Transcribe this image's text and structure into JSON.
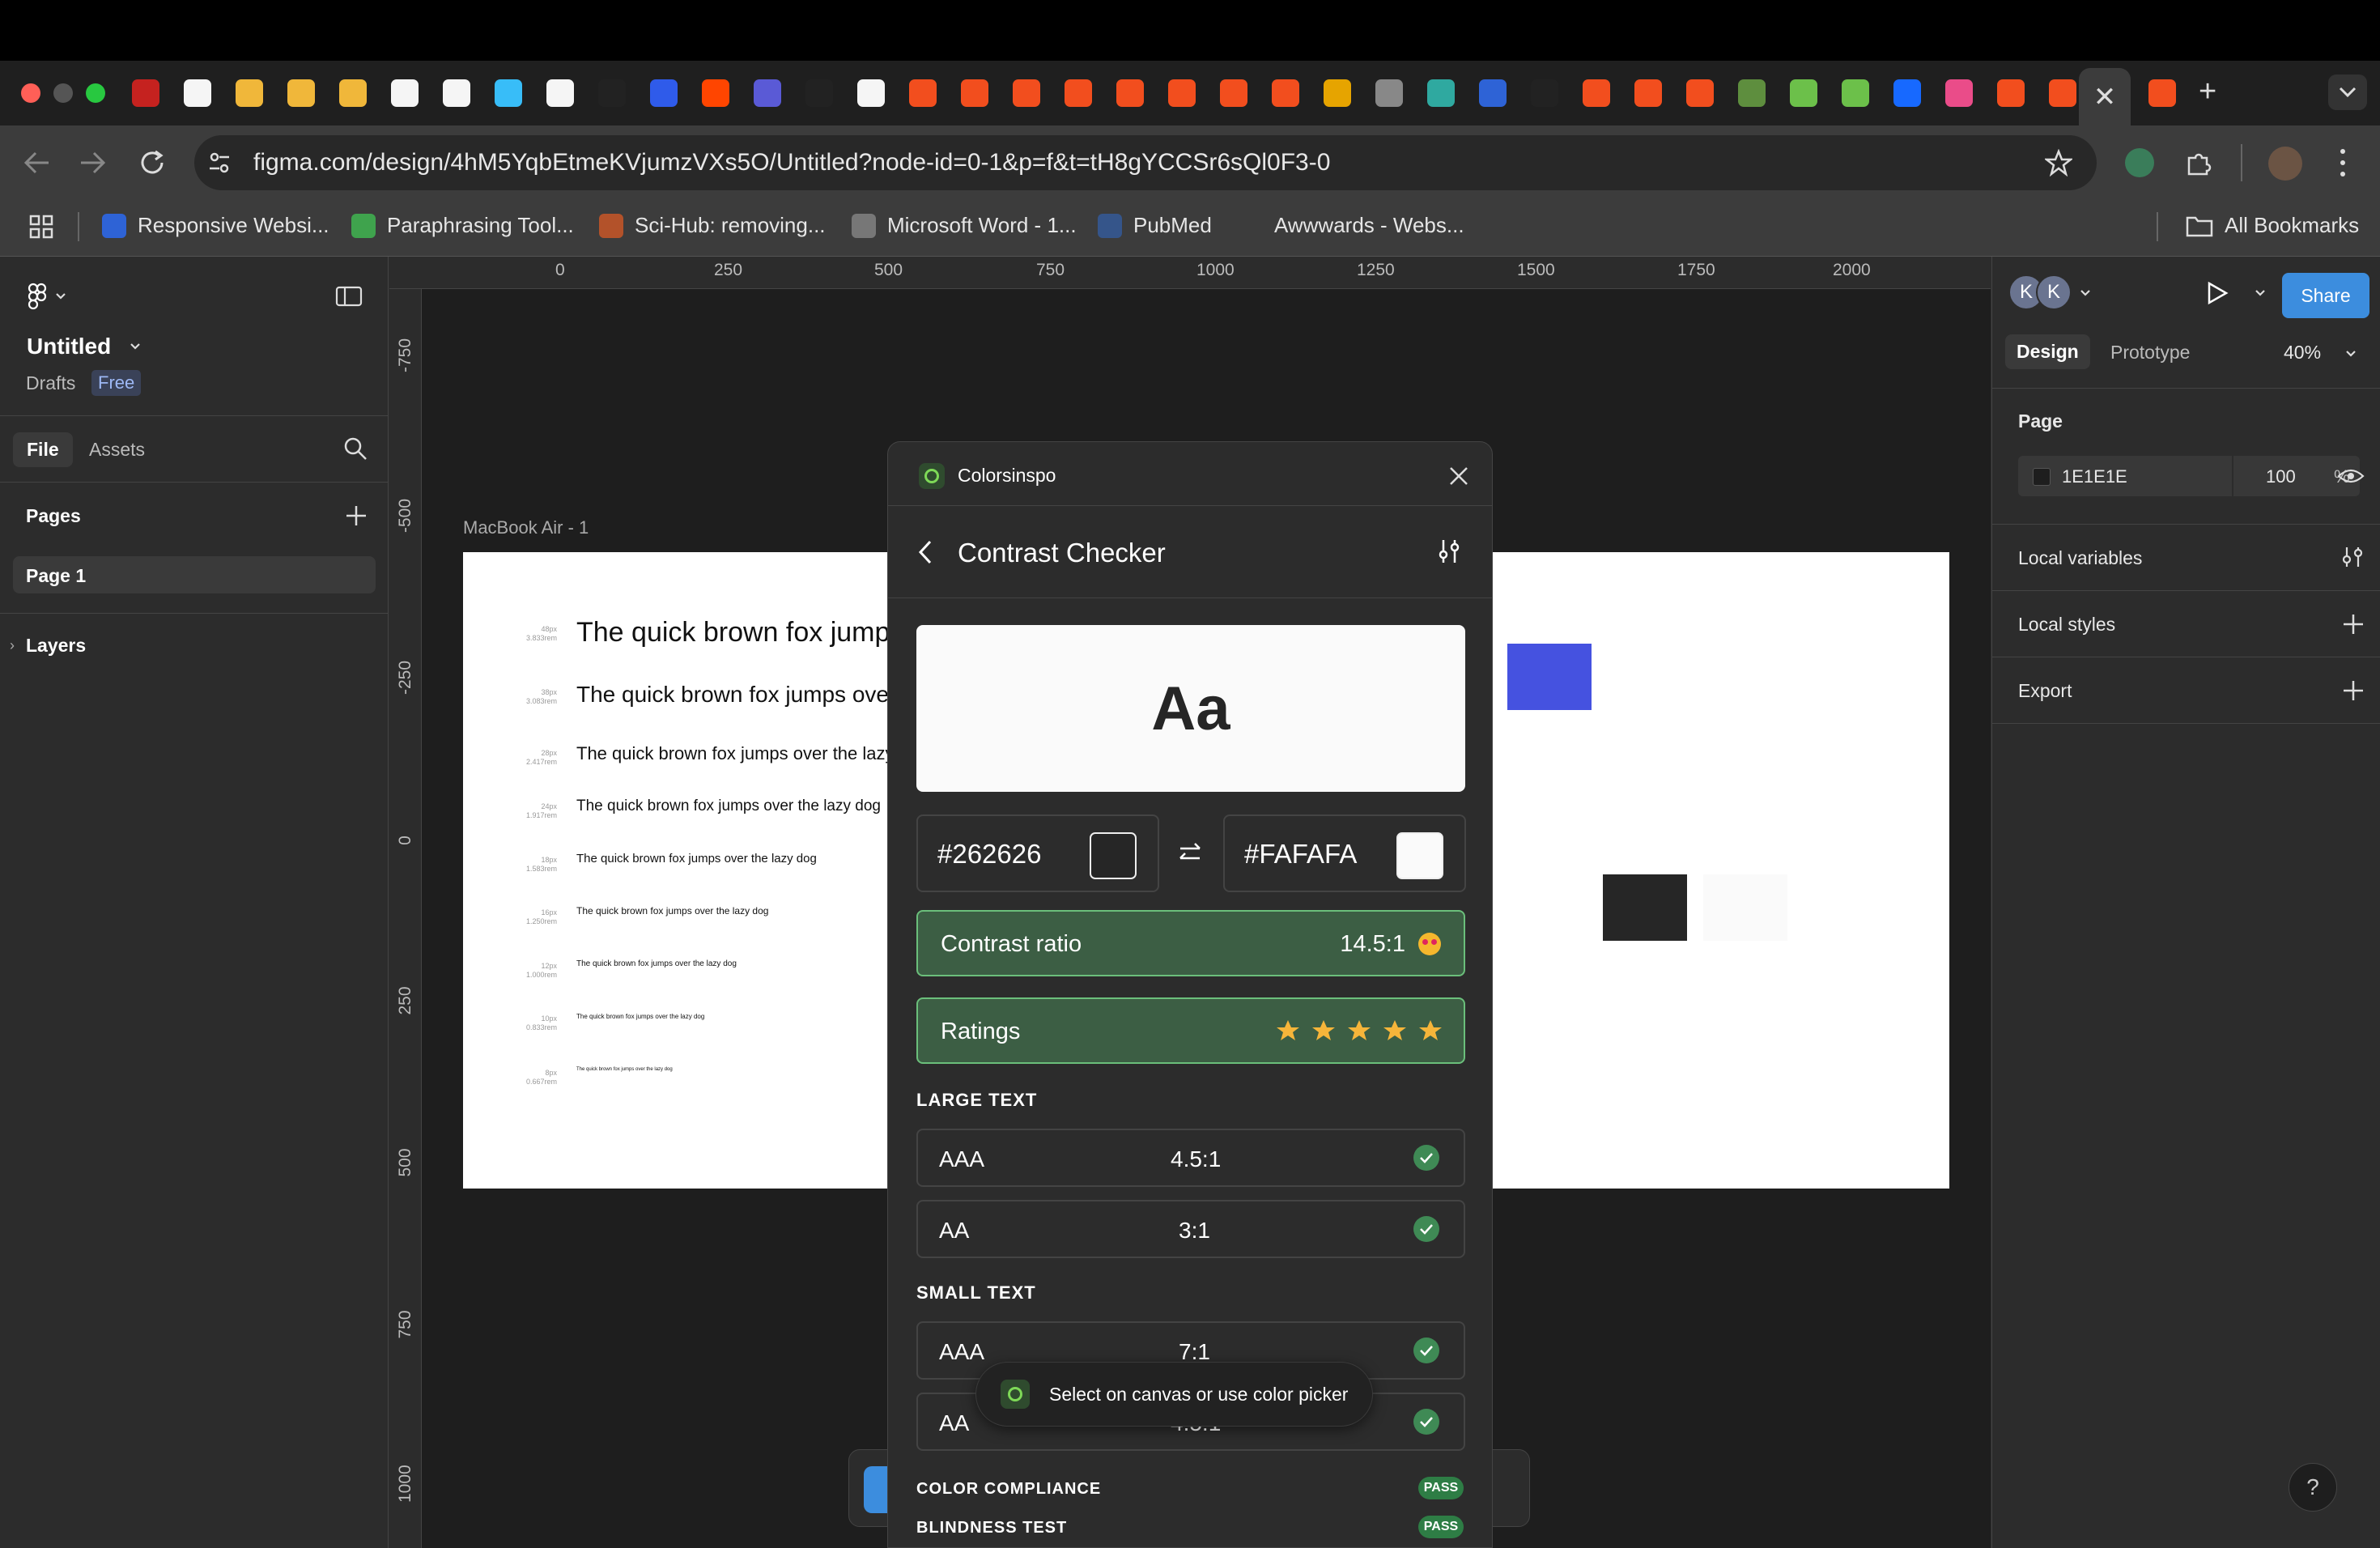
{
  "browser": {
    "active_tab_close": "✕",
    "new_tab": "+",
    "url": "figma.com/design/4hM5YqbEtmeKVjumzVXs5O/Untitled?node-id=0-1&p=f&t=tH8gYCCSr6sQl0F3-0",
    "bookmarks": [
      {
        "label": "Responsive Websi...",
        "icon": "c-logo-icon",
        "color": "#2e63d6"
      },
      {
        "label": "Paraphrasing Tool...",
        "icon": "robot-icon",
        "color": "#3fa34d"
      },
      {
        "label": "Sci-Hub: removing...",
        "icon": "sci-hub-icon",
        "color": "#b3522a"
      },
      {
        "label": "Microsoft Word - 1...",
        "icon": "globe-icon",
        "color": "#777777"
      },
      {
        "label": "PubMed",
        "icon": "pubmed-icon",
        "color": "#35558a"
      },
      {
        "label": "Awwwards - Webs...",
        "icon": "awwwards-icon",
        "color": "#3c3c3c"
      }
    ],
    "all_bookmarks": "All Bookmarks"
  },
  "figma": {
    "file_name": "Untitled",
    "location": "Drafts",
    "plan_badge": "Free",
    "tabs": {
      "file": "File",
      "assets": "Assets"
    },
    "pages_heading": "Pages",
    "pages": [
      "Page 1"
    ],
    "layers_heading": "Layers",
    "ruler_top": [
      "0",
      "250",
      "500",
      "750",
      "1000",
      "1250",
      "1500",
      "1750",
      "2000"
    ],
    "ruler_left": [
      "-750",
      "-500",
      "-250",
      "0",
      "250",
      "500",
      "750",
      "1000"
    ],
    "frame_label": "MacBook Air - 1",
    "samples": [
      {
        "text": "The quick brown fox jumps over the lazy dog",
        "meta1": "48px",
        "meta2": "3.833rem"
      },
      {
        "text": "The quick brown fox jumps over the lazy dog",
        "meta1": "38px",
        "meta2": "3.083rem"
      },
      {
        "text": "The quick brown fox jumps over the lazy dog",
        "meta1": "28px",
        "meta2": "2.417rem"
      },
      {
        "text": "The quick brown fox jumps over the lazy dog",
        "meta1": "24px",
        "meta2": "1.917rem"
      },
      {
        "text": "The quick brown fox jumps over the lazy dog",
        "meta1": "18px",
        "meta2": "1.583rem"
      },
      {
        "text": "The quick brown fox jumps over the lazy dog",
        "meta1": "16px",
        "meta2": "1.250rem"
      },
      {
        "text": "The quick brown fox jumps over the lazy dog",
        "meta1": "12px",
        "meta2": "1.000rem"
      },
      {
        "text": "The quick brown fox jumps over the lazy dog",
        "meta1": "10px",
        "meta2": "0.833rem"
      },
      {
        "text": "The quick brown fox jumps over the lazy dog",
        "meta1": "8px",
        "meta2": "0.667rem"
      }
    ],
    "swatches": {
      "blue": "#4552e0",
      "dark": "#262626",
      "light": "#fafafa"
    }
  },
  "plugin": {
    "name": "Colorsinspo",
    "title": "Contrast Checker",
    "preview_text": "Aa",
    "foreground": "#262626",
    "background": "#FAFAFA",
    "contrast_label": "Contrast ratio",
    "contrast_value": "14.5:1",
    "ratings_label": "Ratings",
    "rating_stars": 5,
    "large_text_heading": "LARGE TEXT",
    "large_text": [
      {
        "level": "AAA",
        "ratio": "4.5:1"
      },
      {
        "level": "AA",
        "ratio": "3:1"
      }
    ],
    "small_text_heading": "SMALL TEXT",
    "small_text": [
      {
        "level": "AAA",
        "ratio": "7:1"
      },
      {
        "level": "AA",
        "ratio": "4.5:1"
      }
    ],
    "toast": "Select on canvas or use color picker",
    "color_compliance": "COLOR COMPLIANCE",
    "blindness_test": "BLINDNESS TEST",
    "pass_label": "PASS"
  },
  "right_panel": {
    "avatars": [
      "K",
      "K"
    ],
    "share": "Share",
    "tabs": {
      "design": "Design",
      "prototype": "Prototype"
    },
    "zoom": "40%",
    "page_heading": "Page",
    "page_color": "1E1E1E",
    "page_opacity": "100",
    "percent": "%",
    "local_variables": "Local variables",
    "local_styles": "Local styles",
    "export": "Export"
  },
  "help": "?"
}
